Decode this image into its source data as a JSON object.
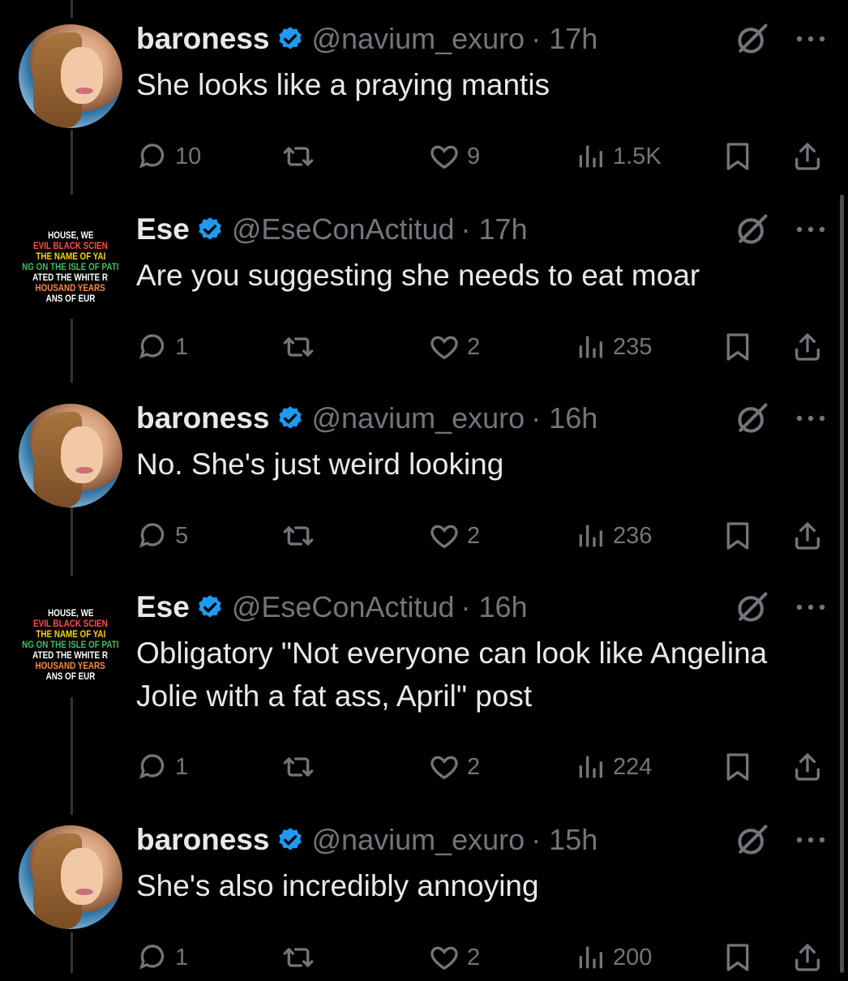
{
  "tweets": [
    {
      "name": "baroness",
      "handle": "@navium_exuro",
      "time": "· 17h",
      "avatar_type": "photo",
      "text": "She looks like a praying mantis",
      "replies": "10",
      "retweets": "",
      "likes": "9",
      "views": "1.5K"
    },
    {
      "name": "Ese",
      "handle": "@EseConActitud",
      "time": "· 17h",
      "avatar_type": "text",
      "text": "Are you suggesting she needs to eat moar",
      "replies": "1",
      "retweets": "",
      "likes": "2",
      "views": "235"
    },
    {
      "name": "baroness",
      "handle": "@navium_exuro",
      "time": "· 16h",
      "avatar_type": "photo",
      "text": "No. She's just weird looking",
      "replies": "5",
      "retweets": "",
      "likes": "2",
      "views": "236"
    },
    {
      "name": "Ese",
      "handle": "@EseConActitud",
      "time": "· 16h",
      "avatar_type": "text",
      "text": "Obligatory \"Not everyone can look like Angelina Jolie with a fat ass, April\" post",
      "replies": "1",
      "retweets": "",
      "likes": "2",
      "views": "224"
    },
    {
      "name": "baroness",
      "handle": "@navium_exuro",
      "time": "· 15h",
      "avatar_type": "photo",
      "text": "She's also incredibly annoying",
      "replies": "1",
      "retweets": "",
      "likes": "2",
      "views": "200"
    }
  ],
  "avatar_text_lines": [
    "HOUSE, WE",
    "EVIL BLACK SCIEN",
    "THE NAME OF YAI",
    "NG ON THE ISLE OF PATI",
    "ATED THE WHITE R",
    "HOUSAND YEARS",
    "ANS OF EUR"
  ],
  "avatar_text_colors": [
    "#ffffff",
    "#ff4d4d",
    "#ffd400",
    "#3fbf5f",
    "#ffffff",
    "#ff8a3d",
    "#ffffff"
  ],
  "colors": {
    "background": "#000000",
    "text_primary": "#e7e9ea",
    "text_secondary": "#71767b",
    "verified_blue": "#1d9bf0",
    "thread_line": "#333639"
  },
  "icons": {
    "verified": "verified-badge-icon",
    "grok": "grok-icon",
    "more": "more-icon",
    "reply": "reply-icon",
    "retweet": "retweet-icon",
    "like": "like-icon",
    "views": "views-icon",
    "bookmark": "bookmark-icon",
    "share": "share-icon"
  }
}
